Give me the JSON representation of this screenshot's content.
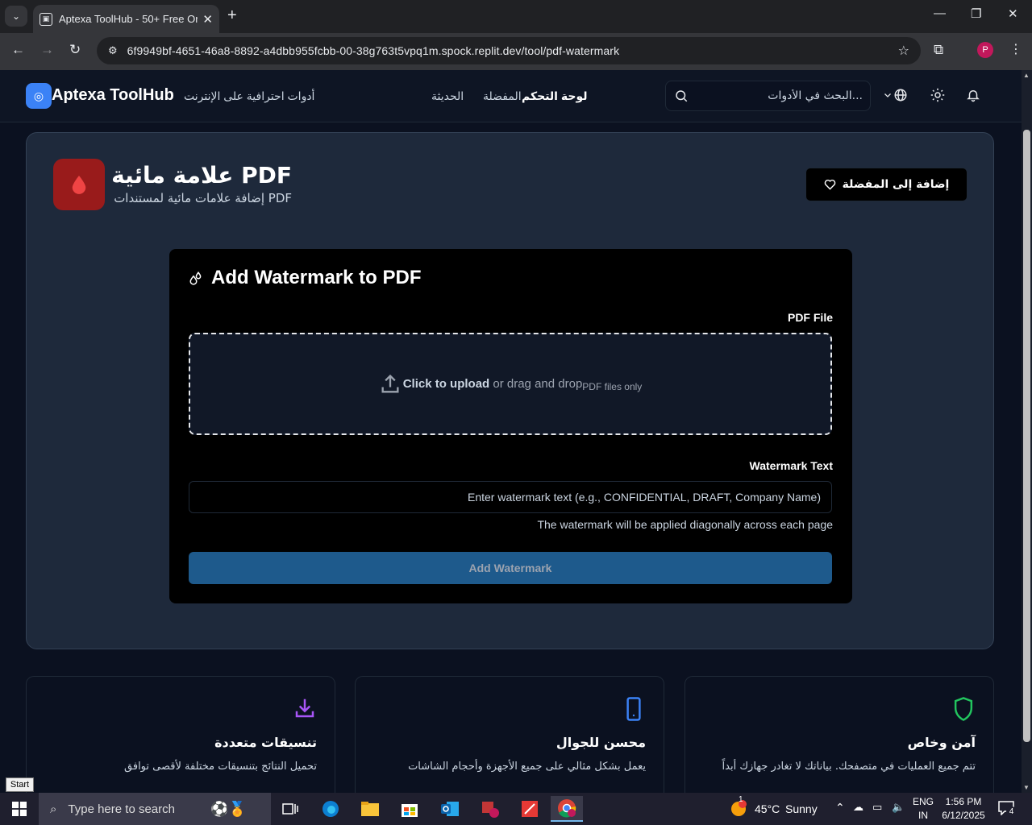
{
  "browser": {
    "tab_title": "Aptexa ToolHub - 50+ Free Onl",
    "url": "6f9949bf-4651-46a8-8892-a4dbb955fcbb-00-38g763t5vpq1m.spock.replit.dev/tool/pdf-watermark",
    "profile_initial": "P"
  },
  "header": {
    "brand": "Aptexa ToolHub",
    "tagline": "أدوات احترافية على الإنترنت",
    "nav": [
      "لوحة التحكم",
      "المفضلة",
      "الحديثة"
    ],
    "search_placeholder": "البحث في الأدوات..."
  },
  "tool": {
    "title": "علامة مائية PDF",
    "subtitle": "إضافة علامات مائية لمستندات PDF",
    "favorite_label": "إضافة إلى المفضلة",
    "accent": "#991b1b"
  },
  "form": {
    "title": "Add Watermark to PDF",
    "file_label": "PDF File",
    "upload_strong": "Click to upload",
    "upload_rest": " or drag and drop",
    "upload_hint": "PDF files only",
    "text_label": "Watermark Text",
    "text_placeholder": "Enter watermark text (e.g., CONFIDENTIAL, DRAFT, Company Name)",
    "text_hint": "The watermark will be applied diagonally across each page",
    "submit_label": "Add Watermark"
  },
  "features": [
    {
      "title": "تنسيقات متعددة",
      "desc": "تحميل النتائج بتنسيقات مختلفة لأقصى توافق",
      "icon": "download-icon",
      "color": "#a855f7"
    },
    {
      "title": "محسن للجوال",
      "desc": "يعمل بشكل مثالي على جميع الأجهزة وأحجام الشاشات",
      "icon": "smartphone-icon",
      "color": "#3b82f6"
    },
    {
      "title": "آمن وخاص",
      "desc": "تتم جميع العمليات في متصفحك. بياناتك لا تغادر جهازك أبداً",
      "icon": "shield-icon",
      "color": "#22c55e"
    }
  ],
  "tooltip": "Start",
  "taskbar": {
    "search_placeholder": "Type here to search",
    "temperature": "45°C",
    "weather": "Sunny",
    "weather_badge": "1",
    "lang": "ENG",
    "region": "IN",
    "time": "1:56 PM",
    "date": "6/12/2025",
    "notifications": "4"
  }
}
